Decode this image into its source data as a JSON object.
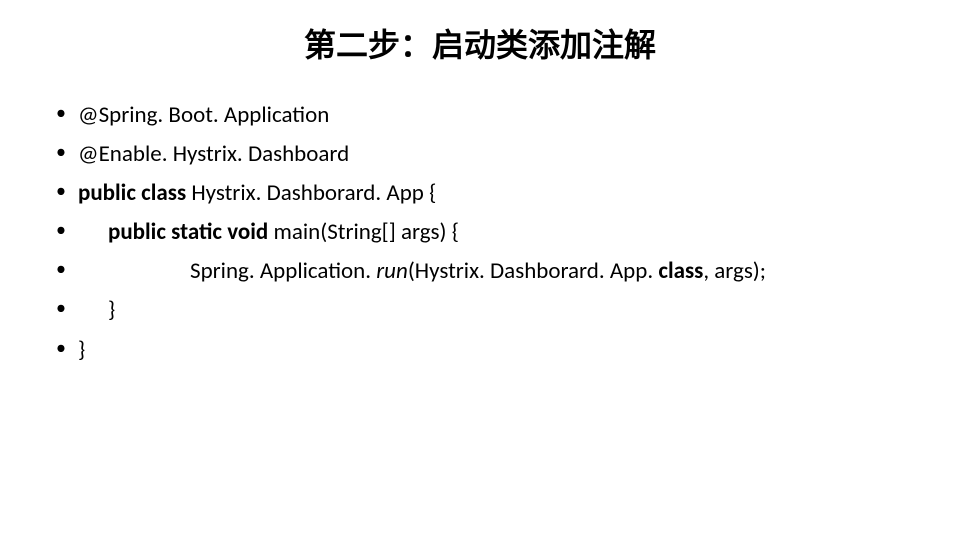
{
  "title": "第二步：启动类添加注解",
  "lines": {
    "l1": "@Spring. Boot. Application",
    "l2": "@Enable. Hystrix. Dashboard",
    "l3_bold": "public class",
    "l3_rest": " Hystrix. Dashborard. App {",
    "l4_bold": "public static void",
    "l4_rest": " main(String[] args) {",
    "l5_a": "Spring. Application. ",
    "l5_italic": "run",
    "l5_b": "(Hystrix. Dashborard. App. ",
    "l5_bold": "class",
    "l5_c": ", args);",
    "l6": "}",
    "l7": "}"
  }
}
